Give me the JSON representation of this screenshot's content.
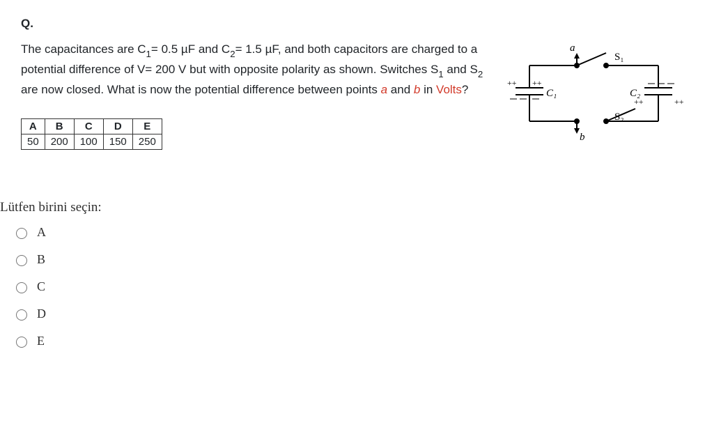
{
  "question": {
    "label": "Q.",
    "text_parts": {
      "p1": "The capacitances are C",
      "s1": "1",
      "p2": "= 0.5 µF and C",
      "s2": "2",
      "p3": "= 1.5 µF, and both capacitors are charged to a potential difference of V= 200 V but with opposite polarity as shown. Switches S",
      "s3": "1",
      "p4": " and S",
      "s4": "2",
      "p5": " are now closed. What is now the potential difference between points ",
      "a": "a",
      "p6": " and ",
      "b": "b",
      "p7": " in ",
      "volts": "Volts",
      "qmark": "?"
    },
    "table": {
      "headers": [
        "A",
        "B",
        "C",
        "D",
        "E"
      ],
      "values": [
        "50",
        "200",
        "100",
        "150",
        "250"
      ]
    }
  },
  "diagram": {
    "a_label": "a",
    "b_label": "b",
    "S1": "S₁",
    "S2": "S₂",
    "C1": "C₁",
    "C2": "C₂",
    "plusplus_left": "++",
    "plusplus_right": "++",
    "plus2": "++",
    "plus2r": "++"
  },
  "choose_label": "Lütfen birini seçin:",
  "options": [
    {
      "label": "A"
    },
    {
      "label": "B"
    },
    {
      "label": "C"
    },
    {
      "label": "D"
    },
    {
      "label": "E"
    }
  ]
}
